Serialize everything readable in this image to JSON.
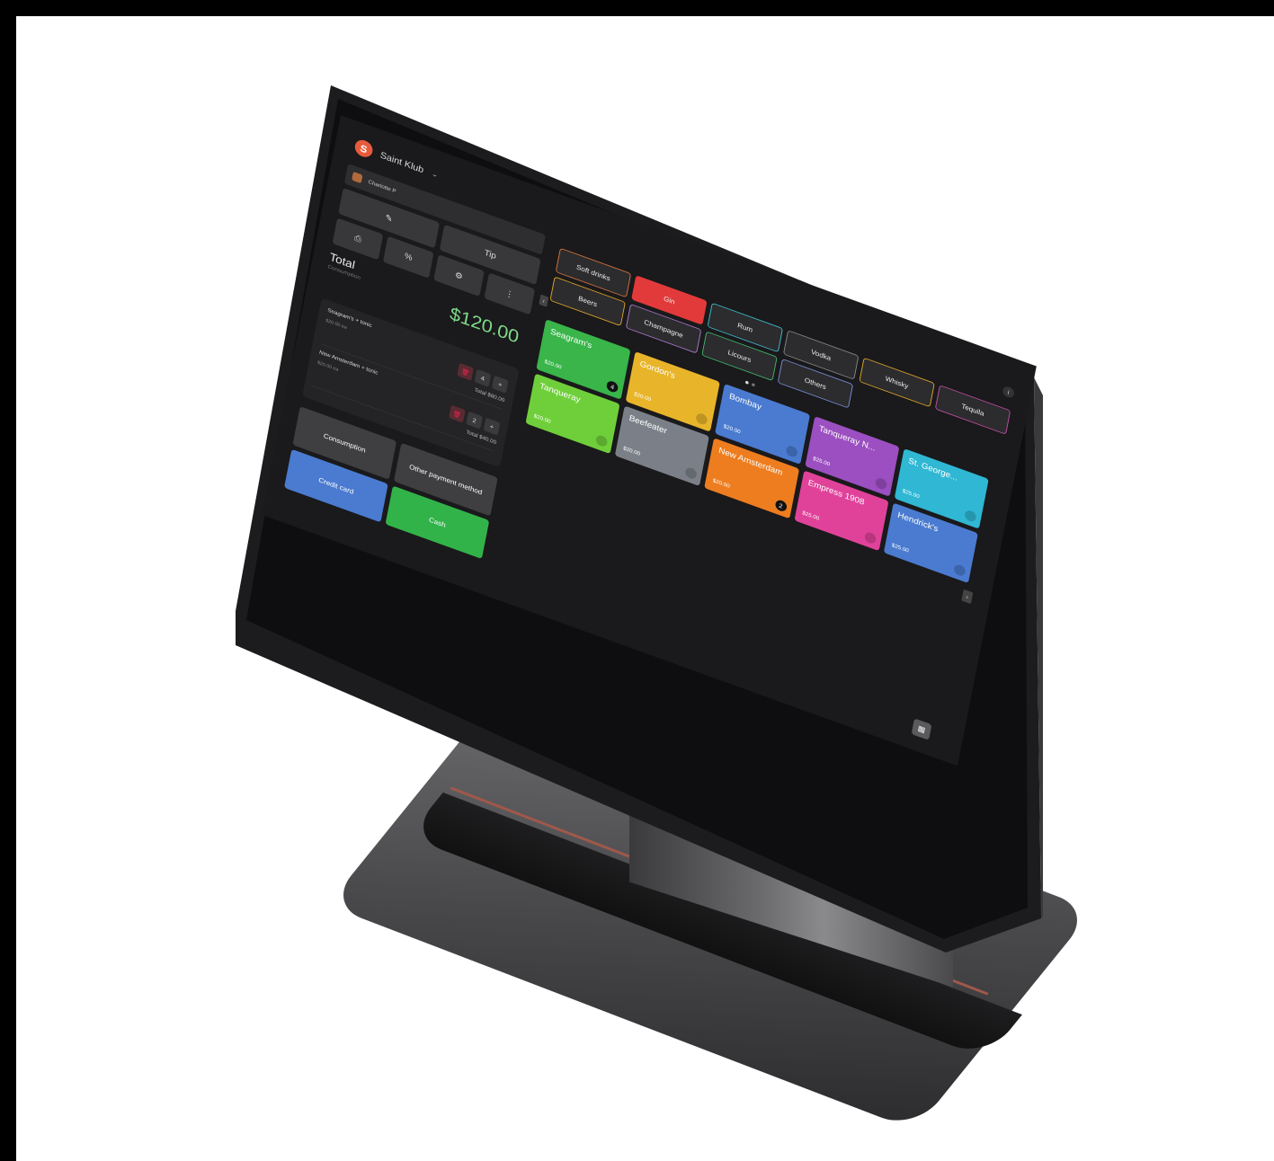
{
  "header": {
    "shop_name": "Saint Klub",
    "logo_glyph": "S",
    "chevron": "⌄"
  },
  "user": {
    "name": "Charlotte P"
  },
  "actions": {
    "tip_label": "Tip"
  },
  "total": {
    "label": "Total",
    "sub": "Consumption",
    "amount": "$120.00"
  },
  "lines": [
    {
      "name": "Seagram's + tonic",
      "price": "$20.00 ea",
      "qty": "4",
      "total": "Total $80.00"
    },
    {
      "name": "New Amsterdam + tonic",
      "price": "$20.00 ea",
      "qty": "2",
      "total": "Total $40.00"
    }
  ],
  "payments": [
    {
      "label": "Consumption",
      "color": "#3f3e41"
    },
    {
      "label": "Other payment method",
      "color": "#3f3e41"
    },
    {
      "label": "Credit card",
      "color": "#4a7bd0"
    },
    {
      "label": "Cash",
      "color": "#32b34a"
    }
  ],
  "categories": [
    {
      "label": "Soft drinks",
      "border": "#d4763d"
    },
    {
      "label": "Gin",
      "border": "#e23a3a",
      "fill": "#e23a3a"
    },
    {
      "label": "Rum",
      "border": "#3fc1cf"
    },
    {
      "label": "Vodka",
      "border": "#888888"
    },
    {
      "label": "Whisky",
      "border": "#e0a928"
    },
    {
      "label": "Tequila",
      "border": "#c24fa6"
    },
    {
      "label": "Beers",
      "border": "#e0a928"
    },
    {
      "label": "Champagne",
      "border": "#b07bd3"
    },
    {
      "label": "Licours",
      "border": "#3fb86e"
    },
    {
      "label": "Others",
      "border": "#7a8fd8"
    }
  ],
  "products": [
    {
      "name": "Seagram's",
      "price": "$20.00",
      "badge": "4",
      "color": "#39b54a"
    },
    {
      "name": "Gordon's",
      "price": "$20.00",
      "badge": "",
      "color": "#e8b52a"
    },
    {
      "name": "Bombay",
      "price": "$20.00",
      "badge": "",
      "color": "#4a7bd0"
    },
    {
      "name": "Tanqueray N...",
      "price": "$25.00",
      "badge": "",
      "color": "#9b4fc0"
    },
    {
      "name": "St. George...",
      "price": "$25.00",
      "badge": "",
      "color": "#2fb7d3"
    },
    {
      "name": "Tanqueray",
      "price": "$20.00",
      "badge": "",
      "color": "#6fcf3a"
    },
    {
      "name": "Beefeater",
      "price": "$20.00",
      "badge": "",
      "color": "#7b8088"
    },
    {
      "name": "New Amsterdam",
      "price": "$20.00",
      "badge": "2",
      "color": "#ee7d1f"
    },
    {
      "name": "Empress 1908",
      "price": "$25.00",
      "badge": "",
      "color": "#e0429a"
    },
    {
      "name": "Hendrick's",
      "price": "$25.00",
      "badge": "",
      "color": "#4a7bd0"
    }
  ]
}
